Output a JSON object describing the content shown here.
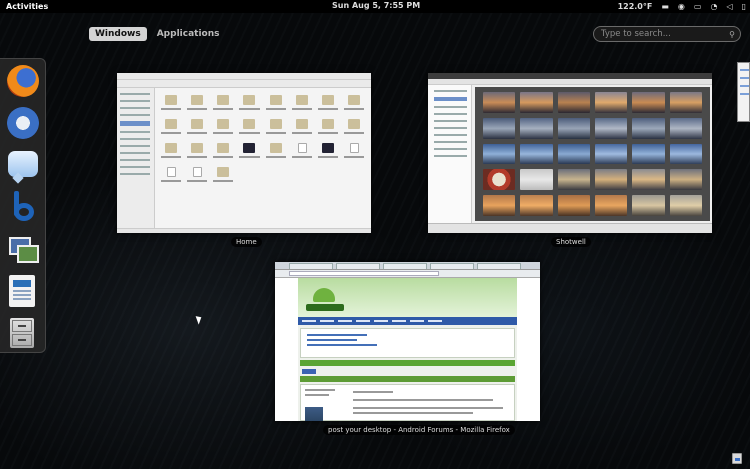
{
  "topbar": {
    "activities": "Activities",
    "clock": "Sun Aug  5,  7:55 PM",
    "temperature": "122.0°F",
    "icons": [
      "folder-icon",
      "accessibility-icon",
      "keyboard-icon",
      "wifi-icon",
      "volume-icon",
      "battery-icon"
    ]
  },
  "overview": {
    "tabs": [
      {
        "label": "Windows",
        "active": true
      },
      {
        "label": "Applications",
        "active": false
      }
    ],
    "search_placeholder": "Type to search..."
  },
  "dash": {
    "items": [
      "firefox",
      "thunderbird",
      "empathy",
      "banshee",
      "shotwell",
      "libreoffice-writer",
      "file-cabinet"
    ]
  },
  "windows": {
    "files_caption": "Home",
    "shotwell_caption": "Shotwell",
    "firefox_caption": "post your desktop - Android Forums - Mozilla Firefox"
  }
}
